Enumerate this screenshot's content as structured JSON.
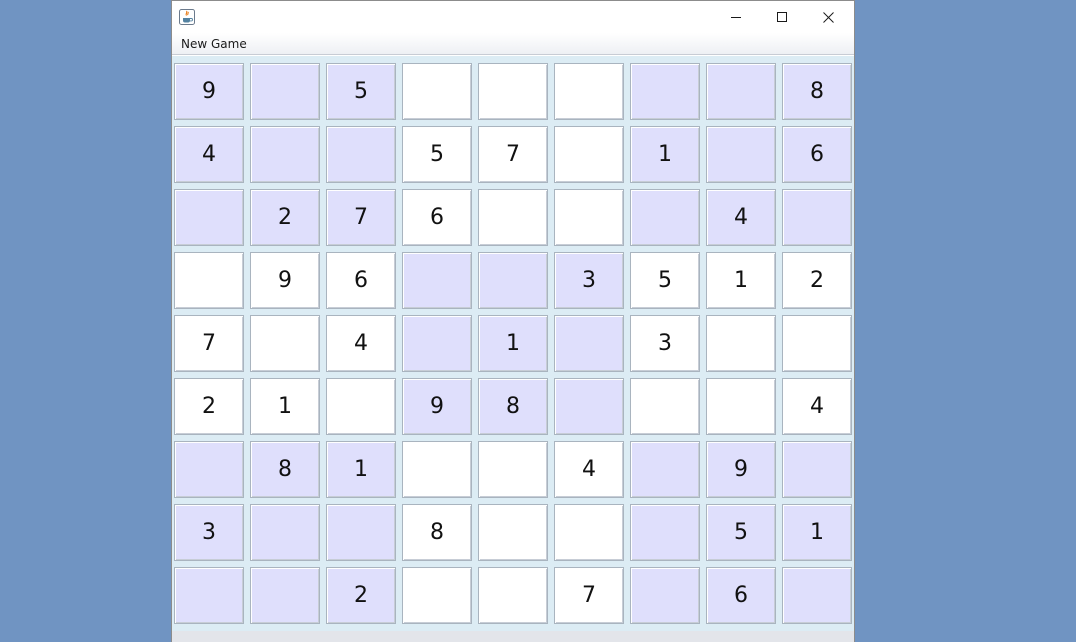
{
  "window": {
    "title": "",
    "icon": "java-cup-icon",
    "controls": [
      "minimize-icon",
      "maximize-icon",
      "close-icon"
    ]
  },
  "menu": {
    "new_game_label": "New Game"
  },
  "colors": {
    "shaded_box": "#dfdffc",
    "plain_box": "#ffffff",
    "desktop": "#7094c2"
  },
  "board": {
    "size": 9,
    "shaded_boxes": [
      [
        0,
        0
      ],
      [
        0,
        2
      ],
      [
        1,
        1
      ],
      [
        2,
        0
      ],
      [
        2,
        2
      ]
    ],
    "rows": [
      [
        "9",
        "",
        "5",
        "",
        "",
        "",
        "",
        "",
        "8"
      ],
      [
        "4",
        "",
        "",
        "5",
        "7",
        "",
        "1",
        "",
        "6"
      ],
      [
        "",
        "2",
        "7",
        "6",
        "",
        "",
        "",
        "4",
        ""
      ],
      [
        "",
        "9",
        "6",
        "",
        "",
        "3",
        "5",
        "1",
        "2"
      ],
      [
        "7",
        "",
        "4",
        "",
        "1",
        "",
        "3",
        "",
        ""
      ],
      [
        "2",
        "1",
        "",
        "9",
        "8",
        "",
        "",
        "",
        "4"
      ],
      [
        "",
        "8",
        "1",
        "",
        "",
        "4",
        "",
        "9",
        ""
      ],
      [
        "3",
        "",
        "",
        "8",
        "",
        "",
        "",
        "5",
        "1"
      ],
      [
        "",
        "",
        "2",
        "",
        "",
        "7",
        "",
        "6",
        ""
      ]
    ]
  }
}
